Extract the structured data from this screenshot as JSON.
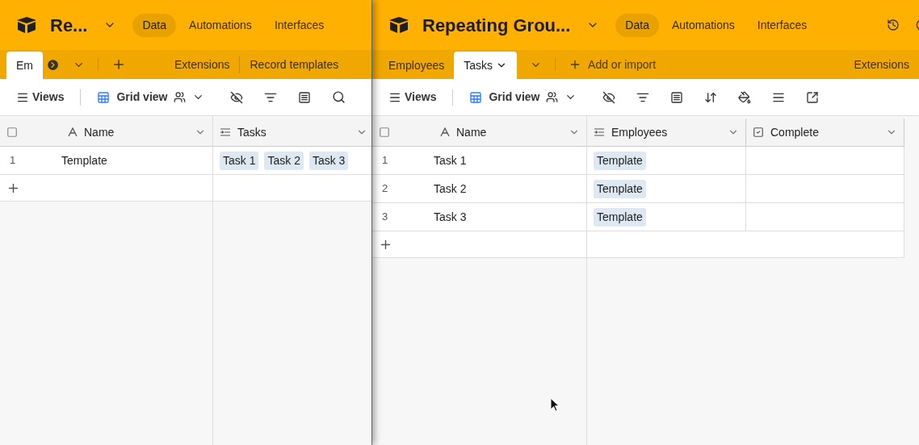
{
  "panes": [
    {
      "base_title": "Re...",
      "all_selected": false,
      "nav": [
        {
          "label": "Data",
          "selected": true
        },
        {
          "label": "Automations",
          "selected": false
        },
        {
          "label": "Interfaces",
          "selected": false
        }
      ],
      "tables": [
        {
          "label": "Em",
          "selected": true
        }
      ],
      "extras": [
        "Extensions",
        "Record templates"
      ],
      "views_label": "Views",
      "view_name": "Grid view",
      "columns": [
        {
          "name": "Name",
          "kind": "text"
        },
        {
          "name": "Tasks",
          "kind": "link"
        }
      ],
      "rows": [
        {
          "number": "1",
          "cells": [
            {
              "text": "Template"
            },
            {
              "chips": [
                "Task 1",
                "Task 2",
                "Task 3"
              ]
            }
          ]
        }
      ]
    },
    {
      "base_title": "Repeating Grou...",
      "all_selected": false,
      "nav": [
        {
          "label": "Data",
          "selected": true
        },
        {
          "label": "Automations",
          "selected": false
        },
        {
          "label": "Interfaces",
          "selected": false
        }
      ],
      "tables": [
        {
          "label": "Employees",
          "selected": false
        },
        {
          "label": "Tasks",
          "selected": true
        }
      ],
      "add_label": "Add or import",
      "extras": [
        "Extensions"
      ],
      "views_label": "Views",
      "view_name": "Grid view",
      "columns": [
        {
          "name": "Name",
          "kind": "text"
        },
        {
          "name": "Employees",
          "kind": "link"
        },
        {
          "name": "Complete",
          "kind": "checkbox"
        }
      ],
      "rows": [
        {
          "number": "1",
          "cells": [
            {
              "text": "Task 1"
            },
            {
              "chips": [
                "Template"
              ]
            },
            {
              "checked": false
            }
          ]
        },
        {
          "number": "2",
          "cells": [
            {
              "text": "Task 2"
            },
            {
              "chips": [
                "Template"
              ]
            },
            {
              "checked": false
            }
          ]
        },
        {
          "number": "3",
          "cells": [
            {
              "text": "Task 3"
            },
            {
              "chips": [
                "Template"
              ]
            },
            {
              "checked": false
            }
          ]
        }
      ]
    }
  ]
}
